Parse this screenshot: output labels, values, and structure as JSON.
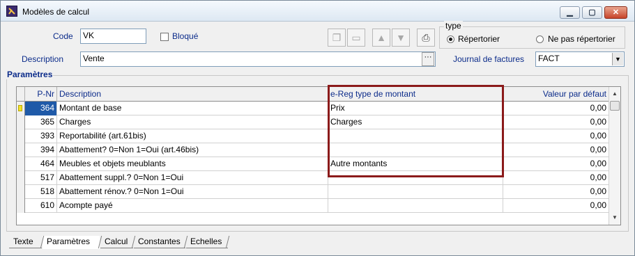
{
  "window": {
    "title": "Modèles de calcul",
    "icon": "app-icon"
  },
  "form": {
    "code_label": "Code",
    "code_value": "VK",
    "bloque_label": "Bloqué",
    "bloque_checked": false,
    "description_label": "Description",
    "description_value": "Vente",
    "type_legend": "type",
    "type_options": [
      "Répertorier",
      "Ne pas répertorier"
    ],
    "type_selected": "Répertorier",
    "journal_label": "Journal de factures",
    "journal_value": "FACT"
  },
  "toolbar": {
    "icons": [
      "copy-icon",
      "window-icon",
      "arrow-up-icon",
      "arrow-down-icon",
      "printer-icon"
    ]
  },
  "params": {
    "title": "Paramètres",
    "columns": [
      "P-Nr",
      "Description",
      "e-Reg type de montant",
      "Valeur par défaut"
    ],
    "rows": [
      {
        "pnr": "364",
        "desc": "Montant de base",
        "ereg": "Prix",
        "val": "0,00"
      },
      {
        "pnr": "365",
        "desc": "Charges",
        "ereg": "Charges",
        "val": "0,00"
      },
      {
        "pnr": "393",
        "desc": "Reportabilité (art.61bis)",
        "ereg": "",
        "val": "0,00"
      },
      {
        "pnr": "394",
        "desc": "Abattement? 0=Non 1=Oui (art.46bis)",
        "ereg": "",
        "val": "0,00"
      },
      {
        "pnr": "464",
        "desc": "Meubles et objets meublants",
        "ereg": "Autre montants",
        "val": "0,00"
      },
      {
        "pnr": "517",
        "desc": "Abattement suppl.? 0=Non 1=Oui",
        "ereg": "",
        "val": "0,00"
      },
      {
        "pnr": "518",
        "desc": "Abattement rénov.? 0=Non 1=Oui",
        "ereg": "",
        "val": "0,00"
      },
      {
        "pnr": "610",
        "desc": "Acompte payé",
        "ereg": "",
        "val": "0,00"
      }
    ]
  },
  "tabs": [
    "Texte",
    "Paramètres",
    "Calcul",
    "Constantes",
    "Echelles"
  ],
  "active_tab": "Paramètres",
  "colors": {
    "label_blue": "#0b2b8a",
    "highlight_red": "#8b1a1a",
    "selection_blue": "#1f5aa8"
  }
}
